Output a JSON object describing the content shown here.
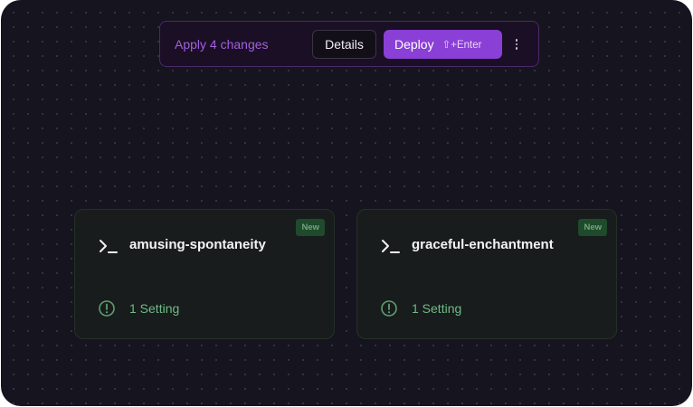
{
  "changes_bar": {
    "apply_label": "Apply 4 changes",
    "details_label": "Details",
    "deploy_label": "Deploy",
    "deploy_shortcut": "⇧+Enter",
    "more_icon": "vertical-ellipsis-icon"
  },
  "services": [
    {
      "name": "amusing-spontaneity",
      "badge": "New",
      "icon": "terminal-icon",
      "setting_label": "1 Setting",
      "setting_icon": "alert-circle-icon"
    },
    {
      "name": "graceful-enchantment",
      "badge": "New",
      "icon": "terminal-icon",
      "setting_label": "1 Setting",
      "setting_icon": "alert-circle-icon"
    }
  ],
  "colors": {
    "canvas_bg": "#15141f",
    "accent_purple": "#8a3fd6",
    "apply_text": "#a35fe0",
    "setting_green": "#6fba86",
    "badge_bg": "#1f4a2c"
  }
}
